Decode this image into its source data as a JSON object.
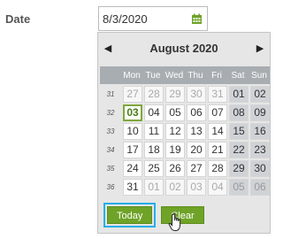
{
  "date_field": {
    "label": "Date",
    "value": "8/3/2020",
    "icon": "calendar-icon"
  },
  "calendar": {
    "prev_label": "◀",
    "next_label": "▶",
    "month_title": "August 2020",
    "day_names": [
      "Mon",
      "Tue",
      "Wed",
      "Thu",
      "Fri",
      "Sat",
      "Sun"
    ],
    "weeks": [
      {
        "week": "31",
        "days": [
          {
            "d": "27",
            "other": true
          },
          {
            "d": "28",
            "other": true
          },
          {
            "d": "29",
            "other": true
          },
          {
            "d": "30",
            "other": true
          },
          {
            "d": "31",
            "other": true
          },
          {
            "d": "01"
          },
          {
            "d": "02"
          }
        ]
      },
      {
        "week": "32",
        "days": [
          {
            "d": "03",
            "selected": true
          },
          {
            "d": "04"
          },
          {
            "d": "05"
          },
          {
            "d": "06"
          },
          {
            "d": "07"
          },
          {
            "d": "08"
          },
          {
            "d": "09"
          }
        ]
      },
      {
        "week": "33",
        "days": [
          {
            "d": "10"
          },
          {
            "d": "11"
          },
          {
            "d": "12"
          },
          {
            "d": "13"
          },
          {
            "d": "14"
          },
          {
            "d": "15"
          },
          {
            "d": "16"
          }
        ]
      },
      {
        "week": "34",
        "days": [
          {
            "d": "17"
          },
          {
            "d": "18"
          },
          {
            "d": "19"
          },
          {
            "d": "20"
          },
          {
            "d": "21"
          },
          {
            "d": "22"
          },
          {
            "d": "23"
          }
        ]
      },
      {
        "week": "35",
        "days": [
          {
            "d": "24"
          },
          {
            "d": "25"
          },
          {
            "d": "26"
          },
          {
            "d": "27"
          },
          {
            "d": "28"
          },
          {
            "d": "29"
          },
          {
            "d": "30"
          }
        ]
      },
      {
        "week": "36",
        "days": [
          {
            "d": "31"
          },
          {
            "d": "01",
            "other": true
          },
          {
            "d": "02",
            "other": true
          },
          {
            "d": "03",
            "other": true
          },
          {
            "d": "04",
            "other": true
          },
          {
            "d": "05",
            "other": true
          },
          {
            "d": "06",
            "other": true
          }
        ]
      }
    ],
    "today_label": "Today",
    "clear_label": "Clear"
  },
  "colors": {
    "accent_green": "#6fa328",
    "highlight_blue": "#27aee8",
    "weekend_bg": "#cfd2d6",
    "header_bar": "#a8adb2"
  }
}
